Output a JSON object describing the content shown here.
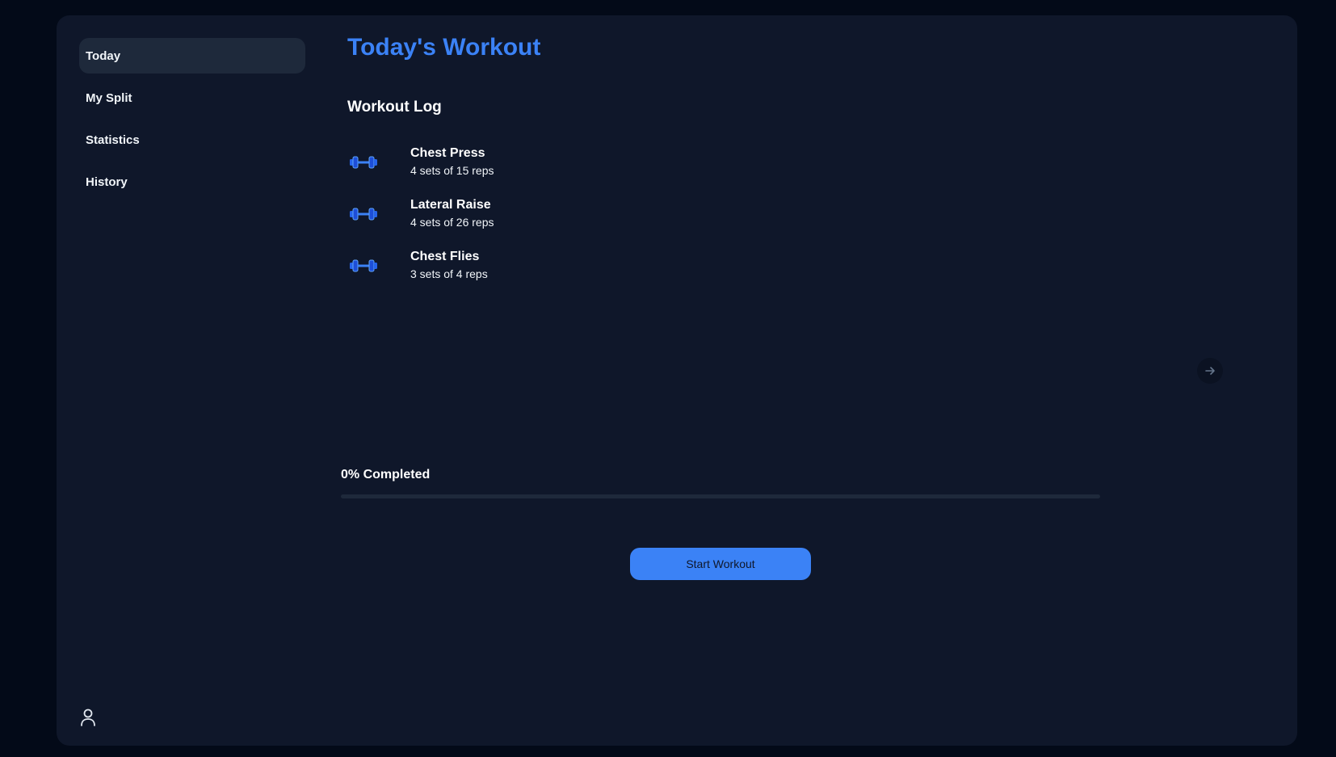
{
  "sidebar": {
    "items": [
      {
        "label": "Today",
        "active": true
      },
      {
        "label": "My Split",
        "active": false
      },
      {
        "label": "Statistics",
        "active": false
      },
      {
        "label": "History",
        "active": false
      }
    ],
    "profile_icon": "user-icon"
  },
  "main": {
    "title": "Today's Workout",
    "section_title": "Workout Log",
    "exercise_icon": "dumbbell-icon",
    "exercises": [
      {
        "name": "Chest Press",
        "detail": "4 sets of 15 reps"
      },
      {
        "name": "Lateral Raise",
        "detail": "4 sets of 26 reps"
      },
      {
        "name": "Chest Flies",
        "detail": "3 sets of 4 reps"
      }
    ],
    "next_icon": "arrow-right-icon",
    "progress": {
      "label": "0% Completed",
      "percent": 0
    },
    "start_button_label": "Start Workout"
  },
  "colors": {
    "page_background": "#030a18",
    "panel_background": "#0f172a",
    "accent": "#3b82f6",
    "active_nav": "#1e293b"
  }
}
